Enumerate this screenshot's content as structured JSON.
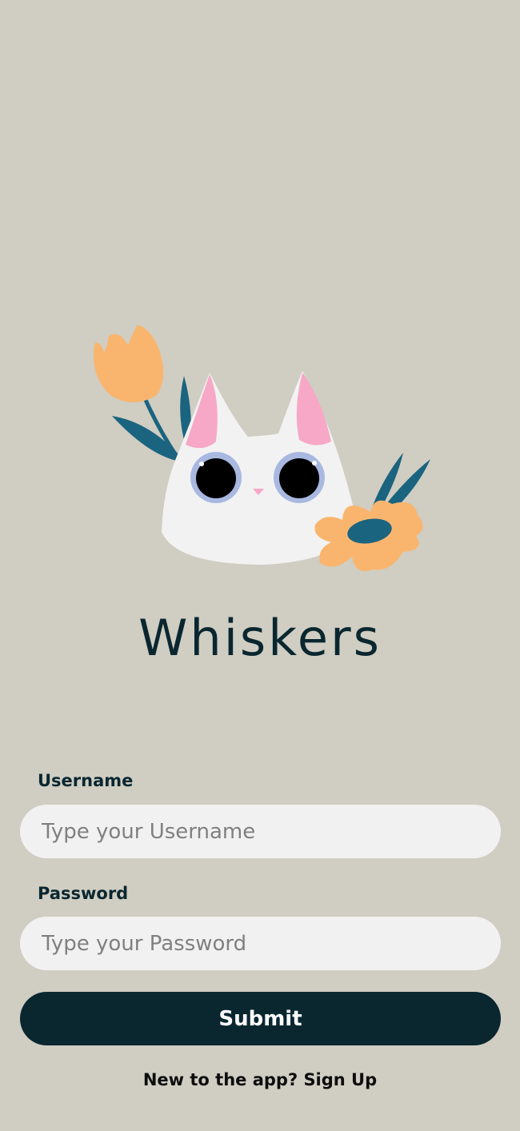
{
  "app": {
    "title": "Whiskers"
  },
  "illustration": {
    "name": "cat-with-flowers-illustration",
    "colors": {
      "background": "#d0cdc2",
      "cat_body": "#f2f2f2",
      "ear_inner": "#f7a8c6",
      "eye_ring": "#a8b8e0",
      "flower_orange": "#f9b56e",
      "leaf_teal": "#1b6480"
    }
  },
  "form": {
    "username": {
      "label": "Username",
      "placeholder": "Type your Username",
      "value": ""
    },
    "password": {
      "label": "Password",
      "placeholder": "Type your Password",
      "value": ""
    },
    "submit_label": "Submit"
  },
  "signup": {
    "prompt": "New to the app?",
    "link_label": "Sign Up"
  },
  "colors": {
    "primary": "#0a2730",
    "input_background": "#f1f1f1"
  }
}
